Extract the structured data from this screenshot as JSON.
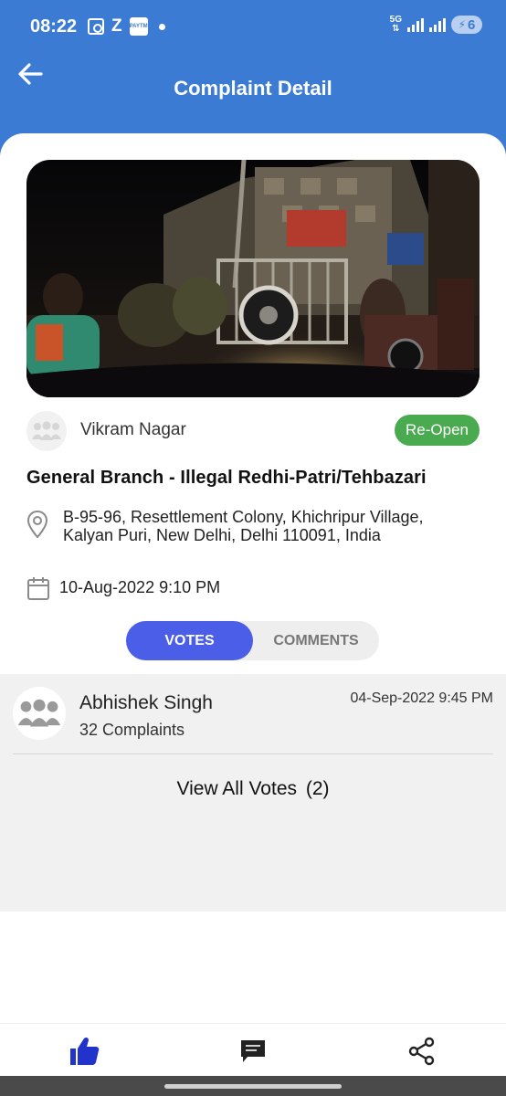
{
  "status_bar": {
    "time": "08:22",
    "z_label": "Z",
    "paytm_label": "PAYTM",
    "network_label": "5G",
    "battery_level": "6"
  },
  "header": {
    "title": "Complaint Detail"
  },
  "complaint": {
    "reporter_name": "Vikram Nagar",
    "status": "Re-Open",
    "status_color": "#4aaa4f",
    "title": "General Branch - Illegal Redhi-Patri/Tehbazari",
    "address": "B-95-96, Resettlement Colony, Khichripur Village, Kalyan Puri, New Delhi, Delhi 110091, India",
    "datetime": "10-Aug-2022 9:10 PM"
  },
  "tabs": [
    {
      "label": "VOTES",
      "active": true
    },
    {
      "label": "COMMENTS",
      "active": false
    }
  ],
  "votes": {
    "items": [
      {
        "name": "Abhishek Singh",
        "complaints": "32 Complaints",
        "date": "04-Sep-2022 9:45 PM"
      }
    ],
    "view_all_label": "View All Votes",
    "view_all_count": "(2)"
  },
  "bottom_nav": {
    "items": [
      {
        "icon": "thumbs-up-icon",
        "color": "#2233cc"
      },
      {
        "icon": "comment-icon",
        "color": "#222222"
      },
      {
        "icon": "share-icon",
        "color": "#222222"
      }
    ]
  },
  "colors": {
    "header_blue": "#3b7bd4",
    "tab_active": "#4a5ee8",
    "like_blue": "#2233cc"
  }
}
